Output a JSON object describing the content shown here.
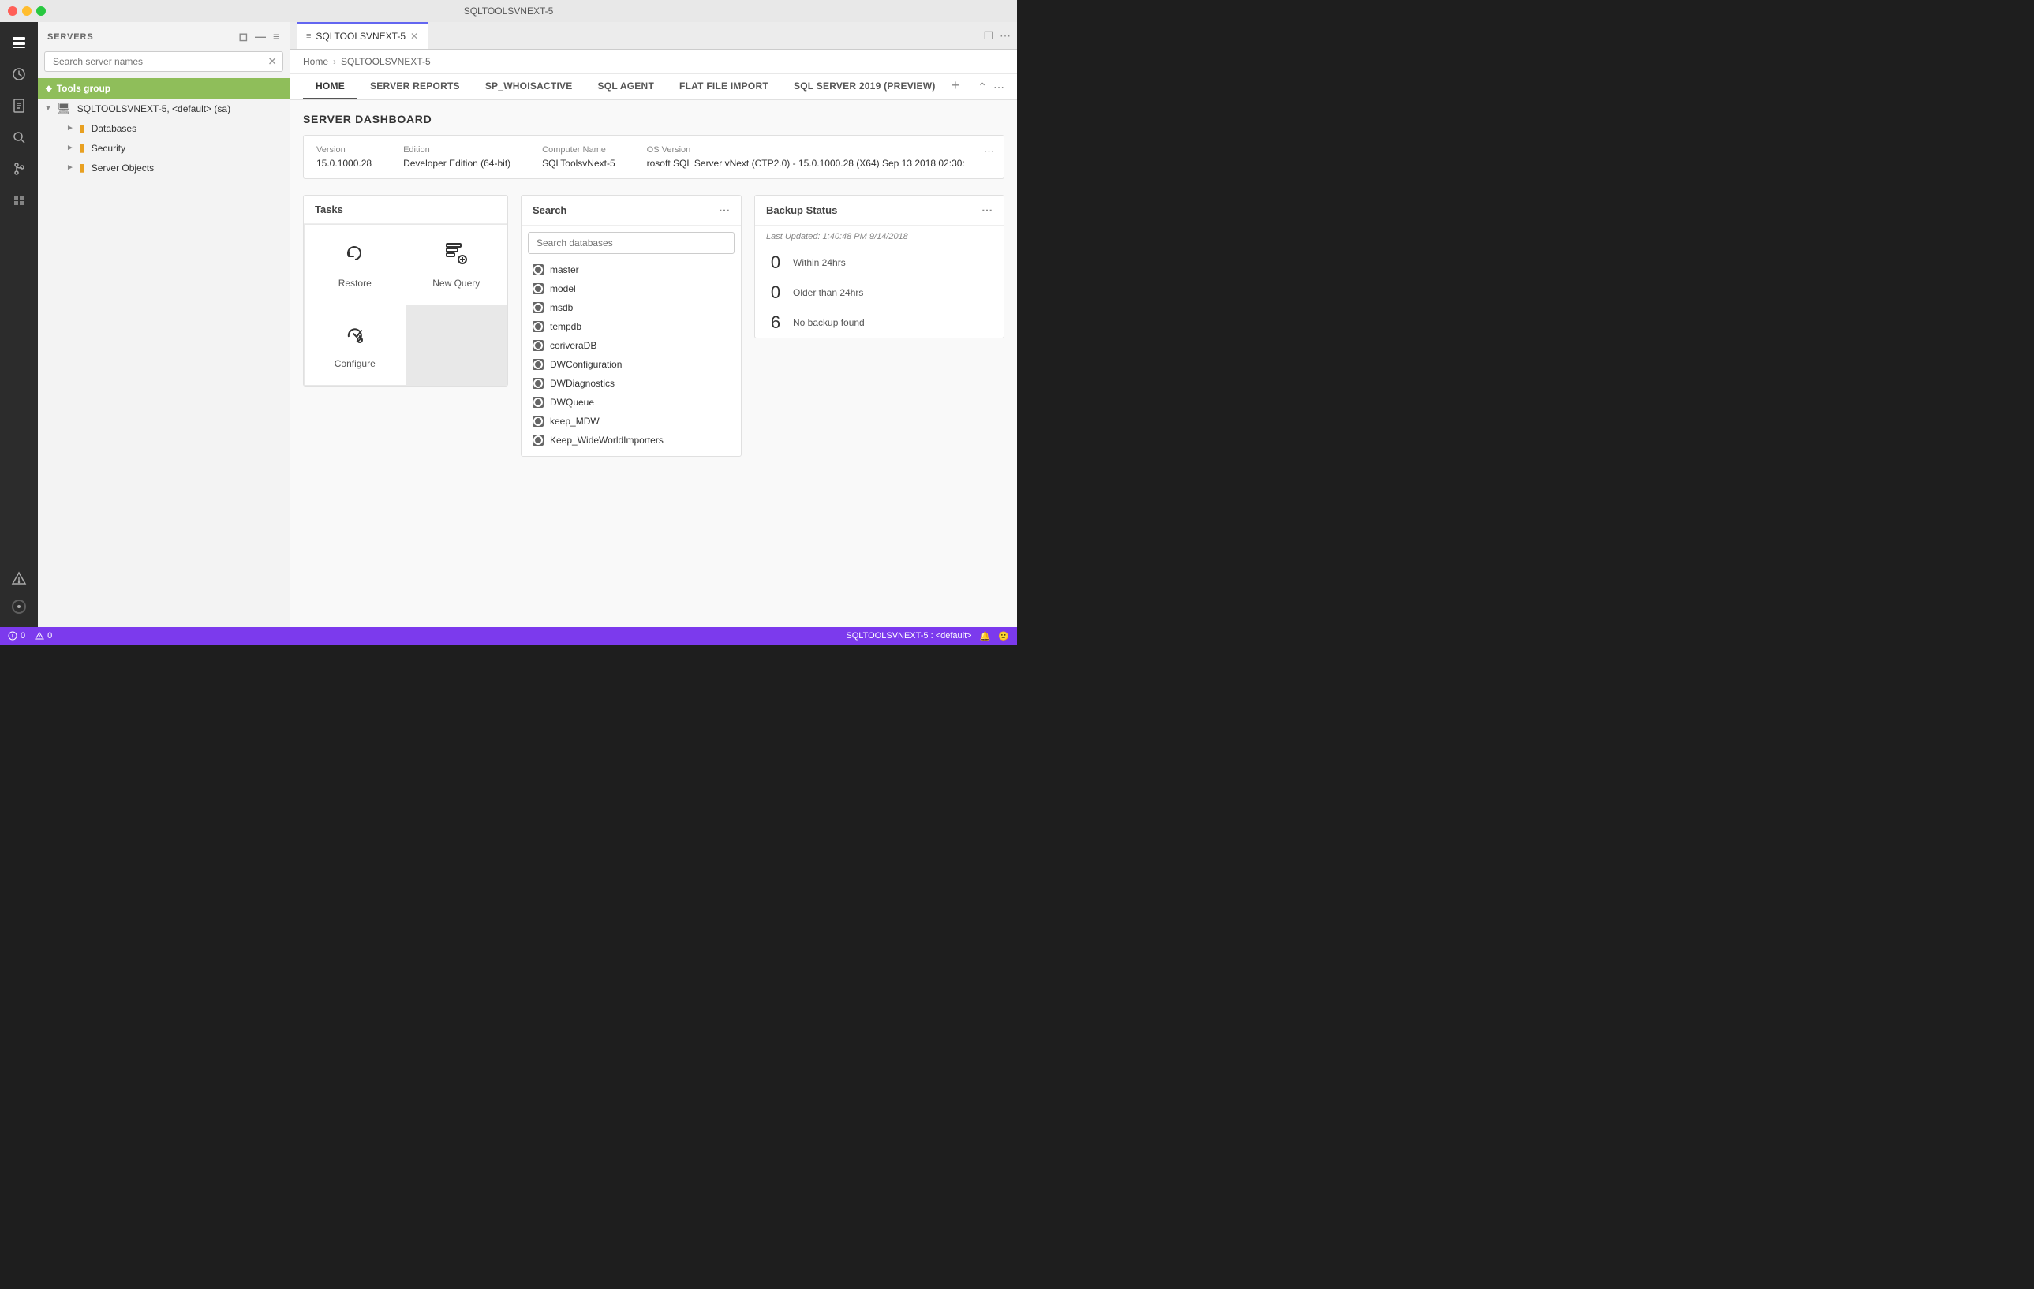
{
  "window": {
    "title": "SQLTOOLSVNEXT-5"
  },
  "activity_bar": {
    "icons": [
      "servers",
      "history",
      "documents",
      "search",
      "git",
      "extensions",
      "warnings",
      "settings"
    ]
  },
  "sidebar": {
    "header": "SERVERS",
    "search_placeholder": "Search server names",
    "group": {
      "name": "Tools group"
    },
    "server": {
      "name": "SQLTOOLSVNEXT-5, <default> (sa)",
      "children": [
        {
          "label": "Databases"
        },
        {
          "label": "Security"
        },
        {
          "label": "Server Objects"
        }
      ]
    }
  },
  "tab": {
    "label": "SQLTOOLSVNEXT-5",
    "icon": "server"
  },
  "breadcrumb": {
    "home": "Home",
    "separator": "›",
    "current": "SQLTOOLSVNEXT-5"
  },
  "nav_tabs": [
    {
      "label": "HOME",
      "active": true
    },
    {
      "label": "SERVER REPORTS",
      "active": false
    },
    {
      "label": "SP_WHOISACTIVE",
      "active": false
    },
    {
      "label": "SQL AGENT",
      "active": false
    },
    {
      "label": "FLAT FILE IMPORT",
      "active": false
    },
    {
      "label": "SQL SERVER 2019 (PREVIEW)",
      "active": false
    }
  ],
  "dashboard": {
    "title": "SERVER DASHBOARD",
    "server_info": {
      "version_label": "Version",
      "version_value": "15.0.1000.28",
      "edition_label": "Edition",
      "edition_value": "Developer Edition (64-bit)",
      "computer_label": "Computer Name",
      "computer_value": "SQLToolsvNext-5",
      "os_label": "OS Version",
      "os_value": "rosoft SQL Server vNext (CTP2.0) - 15.0.1000.28 (X64) Sep 13 2018 02:30:"
    },
    "tasks_widget": {
      "title": "Tasks",
      "items": [
        {
          "label": "Restore",
          "icon": "restore"
        },
        {
          "label": "New Query",
          "icon": "new-query"
        },
        {
          "label": "Configure",
          "icon": "configure"
        }
      ]
    },
    "search_widget": {
      "title": "Search",
      "placeholder": "Search databases",
      "databases": [
        "master",
        "model",
        "msdb",
        "tempdb",
        "coriveraDB",
        "DWConfiguration",
        "DWDiagnostics",
        "DWQueue",
        "keep_MDW",
        "Keep_WideWorldImporters"
      ]
    },
    "backup_widget": {
      "title": "Backup Status",
      "last_updated": "Last Updated: 1:40:48 PM 9/14/2018",
      "stats": [
        {
          "count": "0",
          "label": "Within 24hrs"
        },
        {
          "count": "0",
          "label": "Older than 24hrs"
        },
        {
          "count": "6",
          "label": "No backup found"
        }
      ]
    }
  },
  "status_bar": {
    "left": {
      "alerts_icon": "bell",
      "errors_count": "0",
      "warnings_count": "0"
    },
    "right": {
      "connection": "SQLTOOLSVNEXT-5 : <default>",
      "notification_icon": "bell",
      "feedback_icon": "smiley"
    }
  }
}
